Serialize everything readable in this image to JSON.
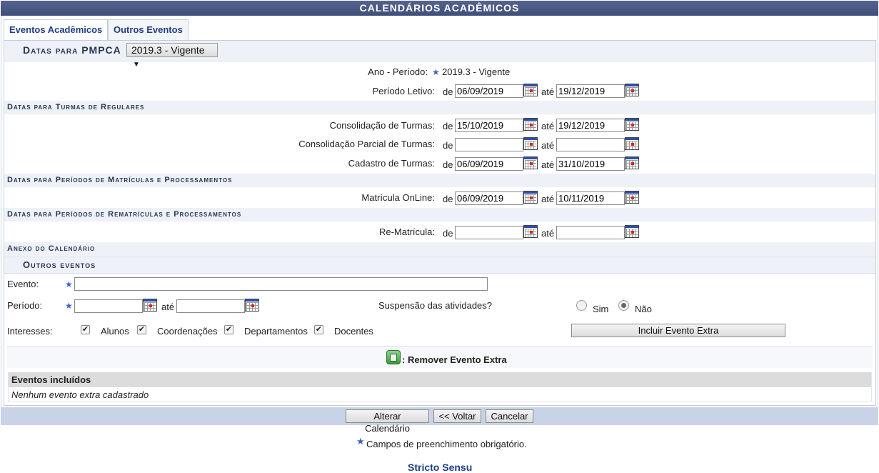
{
  "header": {
    "title": "CALENDÁRIOS ACADÊMICOS"
  },
  "tabs": [
    {
      "label": "Eventos Acadêmicos",
      "active": true
    },
    {
      "label": "Outros Eventos",
      "active": false
    }
  ],
  "pmpca": {
    "heading": "Datas para PMPCA",
    "selected": "2019.3 - Vigente"
  },
  "ano_periodo": {
    "label": "Ano - Período:",
    "value": "2019.3 - Vigente"
  },
  "common": {
    "de": "de",
    "ate": "até"
  },
  "periodo_letivo": {
    "label": "Período Letivo:",
    "from": "06/09/2019",
    "to": "19/12/2019"
  },
  "section_turmas": "Datas para Turmas de Regulares",
  "consolidacao": {
    "label": "Consolidação de Turmas:",
    "from": "15/10/2019",
    "to": "19/12/2019"
  },
  "consolidacao_parcial": {
    "label": "Consolidação Parcial de Turmas:",
    "from": "",
    "to": ""
  },
  "cadastro": {
    "label": "Cadastro de Turmas:",
    "from": "06/09/2019",
    "to": "31/10/2019"
  },
  "section_matriculas": "Datas para Períodos de Matrículas e Processamentos",
  "matricula_online": {
    "label": "Matrícula OnLine:",
    "from": "06/09/2019",
    "to": "10/11/2019"
  },
  "section_rematriculas": "Datas para Períodos de Rematrículas e Processamentos",
  "rematricula": {
    "label": "Re-Matrícula:",
    "from": "",
    "to": ""
  },
  "section_anexo": "Anexo do Calendário",
  "outros": {
    "heading": "Outros eventos",
    "evento_label": "Evento:",
    "evento_value": "",
    "periodo_label": "Período:",
    "periodo_from": "",
    "periodo_to": "",
    "suspensao_label": "Suspensão das atividades?",
    "sim": "Sim",
    "nao": "Não",
    "interesses_label": "Interesses:",
    "interesses": [
      "Alunos",
      "Coordenações",
      "Departamentos",
      "Docentes"
    ],
    "incluir_button": "Incluir Evento Extra",
    "remover_label": ": Remover Evento Extra",
    "eventos_incluidos": "Eventos incluídos",
    "nenhum": "Nenhum evento extra cadastrado"
  },
  "buttons": {
    "alterar": "Alterar Calendário",
    "voltar": "<< Voltar",
    "cancelar": "Cancelar"
  },
  "footer": {
    "required_note": "Campos de preenchimento obrigatório.",
    "link": "Stricto Sensu"
  },
  "colors": {
    "header": "#4a5a86",
    "band": "#eef1f7",
    "link": "#1f3e84"
  }
}
